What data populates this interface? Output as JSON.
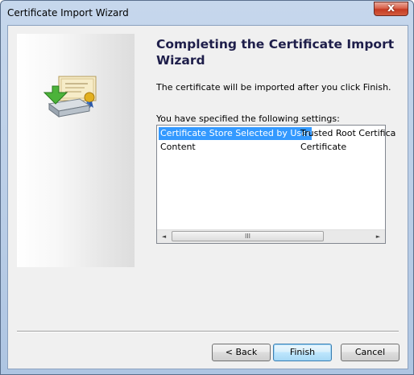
{
  "window": {
    "title": "Certificate Import Wizard",
    "close_label": "x"
  },
  "page": {
    "heading": "Completing the Certificate Import Wizard",
    "description": "The certificate will be imported after you click Finish.",
    "settings_label": "You have specified the following settings:"
  },
  "settings": {
    "rows": [
      {
        "key": "Certificate Store Selected by User",
        "value": "Trusted Root Certifica",
        "selected": true
      },
      {
        "key": "Content",
        "value": "Certificate",
        "selected": false
      }
    ],
    "scrollbar": {
      "left_arrow": "◄",
      "right_arrow": "►",
      "thumb_grip": "III"
    }
  },
  "buttons": {
    "back": "< Back",
    "finish": "Finish",
    "cancel": "Cancel"
  },
  "colors": {
    "selection": "#3399ff",
    "heading": "#1e1e4a",
    "close_button": "#c43a22"
  },
  "icons": {
    "wizard_graphic": "certificate-import-icon"
  }
}
